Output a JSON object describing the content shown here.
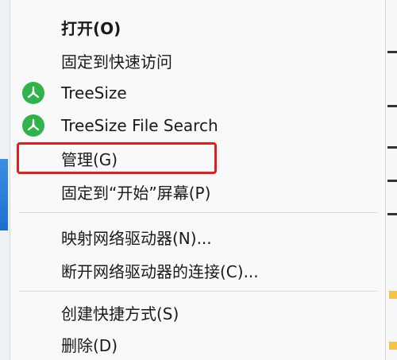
{
  "context_menu": {
    "items": [
      {
        "label": "打开(O)",
        "bold": true
      },
      {
        "label": "固定到快速访问"
      },
      {
        "label": "TreeSize",
        "icon": "treesize-icon"
      },
      {
        "label": "TreeSize File Search",
        "icon": "treesize-icon"
      },
      {
        "label": "管理(G)",
        "highlighted": true
      },
      {
        "label": "固定到“开始”屏幕(P)"
      },
      {
        "label": "映射网络驱动器(N)..."
      },
      {
        "label": "断开网络驱动器的连接(C)..."
      },
      {
        "label": "创建快捷方式(S)"
      },
      {
        "label": "删除(D)"
      }
    ]
  },
  "colors": {
    "menu_background": "#f9f9f9",
    "treesize_icon": "#2fb34a",
    "highlight_border": "#e02020",
    "separator": "#dcdcdc"
  }
}
